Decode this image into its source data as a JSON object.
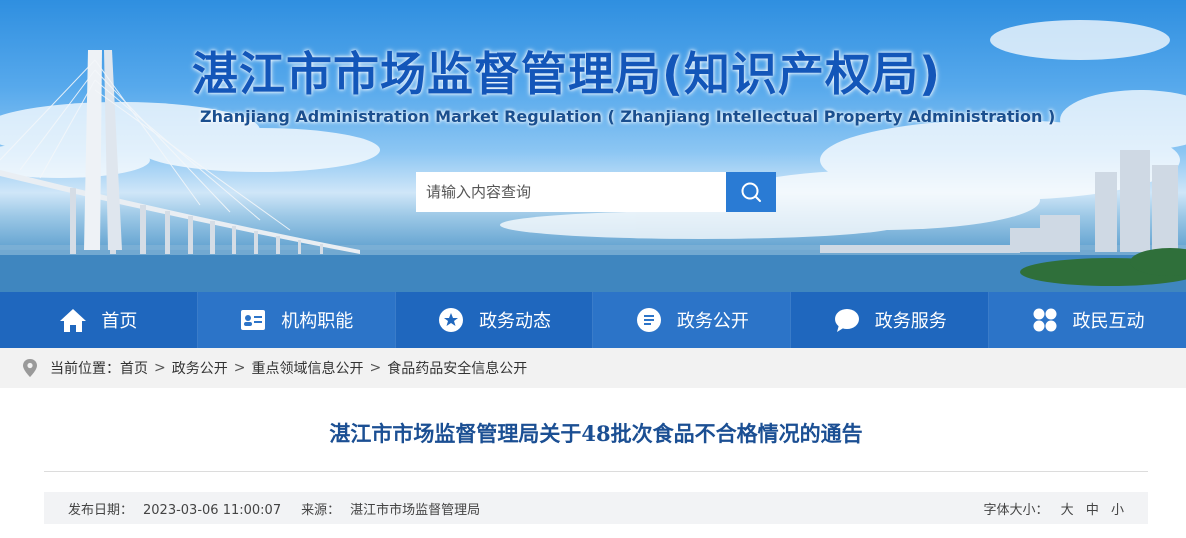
{
  "header": {
    "title": "湛江市市场监督管理局(知识产权局)",
    "subtitle": "Zhanjiang Administration Market Regulation ( Zhanjiang Intellectual Property Administration )"
  },
  "search": {
    "placeholder": "请输入内容查询",
    "button_icon": "search-icon"
  },
  "nav": {
    "items": [
      {
        "label": "首页",
        "icon": "home-icon"
      },
      {
        "label": "机构职能",
        "icon": "id-card-icon"
      },
      {
        "label": "政务动态",
        "icon": "star-icon"
      },
      {
        "label": "政务公开",
        "icon": "document-icon"
      },
      {
        "label": "政务服务",
        "icon": "chat-bubble-icon"
      },
      {
        "label": "政民互动",
        "icon": "grid-icon"
      }
    ]
  },
  "breadcrumb": {
    "prefix": "当前位置：",
    "items": [
      "首页",
      "政务公开",
      "重点领域信息公开",
      "食品药品安全信息公开"
    ],
    "separator": ">"
  },
  "article": {
    "title": "湛江市市场监督管理局关于48批次食品不合格情况的通告",
    "publish_label": "发布日期：",
    "publish_date": "2023-03-06 11:00:07",
    "source_label": "来源：",
    "source": "湛江市市场监督管理局",
    "font_size_label": "字体大小：",
    "font_sizes": [
      "大",
      "中",
      "小"
    ]
  },
  "colors": {
    "nav_bg": "#1f67be",
    "nav_alt_bg": "#2c74c8",
    "title_blue": "#1356b9",
    "article_title": "#1b4f93",
    "search_button": "#2a7bd4"
  }
}
